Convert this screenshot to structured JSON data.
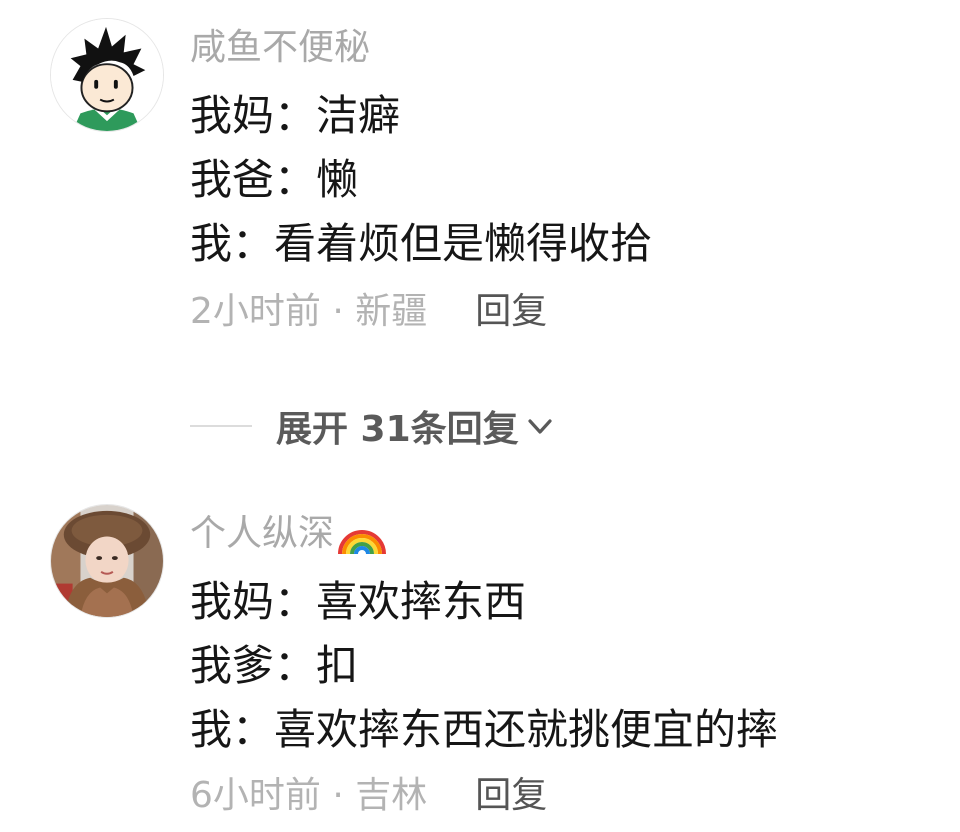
{
  "comments": [
    {
      "username": "咸鱼不便秘",
      "lines": [
        "我妈：洁癖",
        "我爸：懒",
        "我：看着烦但是懒得收拾"
      ],
      "meta": "2小时前 · 新疆",
      "reply_label": "回复",
      "avatar": "cartoon-boy-avatar"
    },
    {
      "username": "个人纵深",
      "username_emoji": "rainbow-icon",
      "lines": [
        "我妈：喜欢摔东西",
        "我爹：扣",
        "我：喜欢摔东西还就挑便宜的摔"
      ],
      "meta": "6小时前 · 吉林",
      "reply_label": "回复",
      "avatar": "photo-girl-avatar"
    }
  ],
  "expand": {
    "label": "展开 31条回复",
    "icon": "chevron-down-icon"
  }
}
